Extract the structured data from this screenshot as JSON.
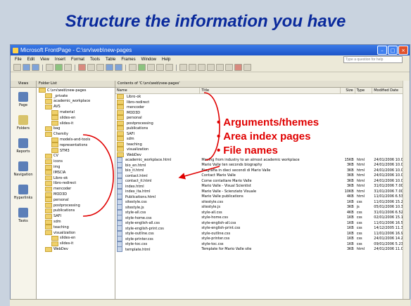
{
  "slide": {
    "title": "Structure the information you have"
  },
  "window": {
    "title": "Microsoft FrontPage - C:\\srv\\web\\new-pages",
    "help_placeholder": "Type a question for help",
    "menu": [
      "File",
      "Edit",
      "View",
      "Insert",
      "Format",
      "Tools",
      "Table",
      "Frames",
      "Window",
      "Help"
    ],
    "views_header": "Views",
    "views": [
      "Page",
      "Folders",
      "Reports",
      "Navigation",
      "Hyperlinks",
      "Tasks"
    ],
    "folder_list_header": "Folder List",
    "folders": [
      "C:\\srv\\web\\new-pages",
      "_private",
      "academic_workplace",
      "AVS",
      "material",
      "slides-en",
      "slides-it",
      "bag",
      "Chemity",
      "models-and-tools",
      "representations",
      "STM3",
      "CV",
      "icons",
      "img",
      "IMSCIA",
      "Libro-ok",
      "libro-redirect",
      "mencoder",
      "MOD3D",
      "personal",
      "postprocessing",
      "publications",
      "SAFI",
      "sdm",
      "teaching",
      "visualization",
      "slides-en",
      "slides-it",
      "WebDev"
    ],
    "contents_path": "Contents of 'C:\\srv\\web\\new-pages'",
    "columns": [
      "Name",
      "Title",
      "Size",
      "Type",
      "Modified Date"
    ],
    "dirs": [
      "Libro-ok",
      "libro-redirect",
      "mencoder",
      "MOD3D",
      "personal",
      "postprocessing",
      "publications",
      "SAFI",
      "sdm",
      "teaching",
      "visualization",
      "WebDev"
    ],
    "files": [
      {
        "name": "academic_workplace.html",
        "title": "Moving from industry to an almost academic workplace",
        "size": "15KB",
        "type": "html",
        "date": "24/01/2006 10.08"
      },
      {
        "name": "bio_en.html",
        "title": "Mario Valle ten seconds biography",
        "size": "3KB",
        "type": "html",
        "date": "24/01/2006 10.08"
      },
      {
        "name": "bio_it.html",
        "title": "Biografia in dieci secondi di Mario Valle",
        "size": "3KB",
        "type": "html",
        "date": "24/01/2006 10.08"
      },
      {
        "name": "contact.html",
        "title": "Contact Mario Valle",
        "size": "3KB",
        "type": "html",
        "date": "24/01/2006 10.08"
      },
      {
        "name": "contact_it.html",
        "title": "Come contattare Mario Valle",
        "size": "3KB",
        "type": "html",
        "date": "24/01/2006 10.08"
      },
      {
        "name": "index.html",
        "title": "Mario Valle - Visual Scientist",
        "size": "3KB",
        "type": "html",
        "date": "31/01/2006 7.00"
      },
      {
        "name": "index_ita.html",
        "title": "Mario Valle - Scienziato Visuale",
        "size": "10KB",
        "type": "html",
        "date": "31/01/2006 7.00"
      },
      {
        "name": "Publications.html",
        "title": "Mario Valle publications",
        "size": "4KB",
        "type": "html",
        "date": "11/01/2006 6.53"
      },
      {
        "name": "sitestyle.css",
        "title": "sitestyle.css",
        "size": "1KB",
        "type": "css",
        "date": "11/01/2006 15.27"
      },
      {
        "name": "sitestyle.js",
        "title": "sitestyle.js",
        "size": "3KB",
        "type": "js",
        "date": "05/01/2006 10.30"
      },
      {
        "name": "style-all.css",
        "title": "style-all.css",
        "size": "4KB",
        "type": "css",
        "date": "31/01/2006 6.52"
      },
      {
        "name": "style-home.css",
        "title": "style-home.css",
        "size": "1KB",
        "type": "css",
        "date": "02/01/2006 15.19"
      },
      {
        "name": "style-english-all.css",
        "title": "style-english-all.css",
        "size": "1KB",
        "type": "css",
        "date": "11/01/2006 16.54"
      },
      {
        "name": "style-english-print.css",
        "title": "style-english-print.css",
        "size": "1KB",
        "type": "css",
        "date": "14/12/2005 11.33"
      },
      {
        "name": "style-outline.css",
        "title": "style-outline.css",
        "size": "1KB",
        "type": "css",
        "date": "11/01/2006 16.96"
      },
      {
        "name": "style-printer.css",
        "title": "style-printer.css",
        "size": "1KB",
        "type": "css",
        "date": "24/01/2006 14.29"
      },
      {
        "name": "style-toc.css",
        "title": "style-toc.css",
        "size": "1KB",
        "type": "css",
        "date": "09/01/2006 5.23"
      },
      {
        "name": "template.html",
        "title": "Template for Mario Valle site",
        "size": "3KB",
        "type": "html",
        "date": "24/01/2006 11.09"
      }
    ]
  },
  "annotations": [
    "Arguments/themes",
    "Area index pages",
    "File names"
  ],
  "colors": {
    "slide_bg": "#c9d3df",
    "title": "#0a2a9c",
    "annotation": "#e00000"
  }
}
